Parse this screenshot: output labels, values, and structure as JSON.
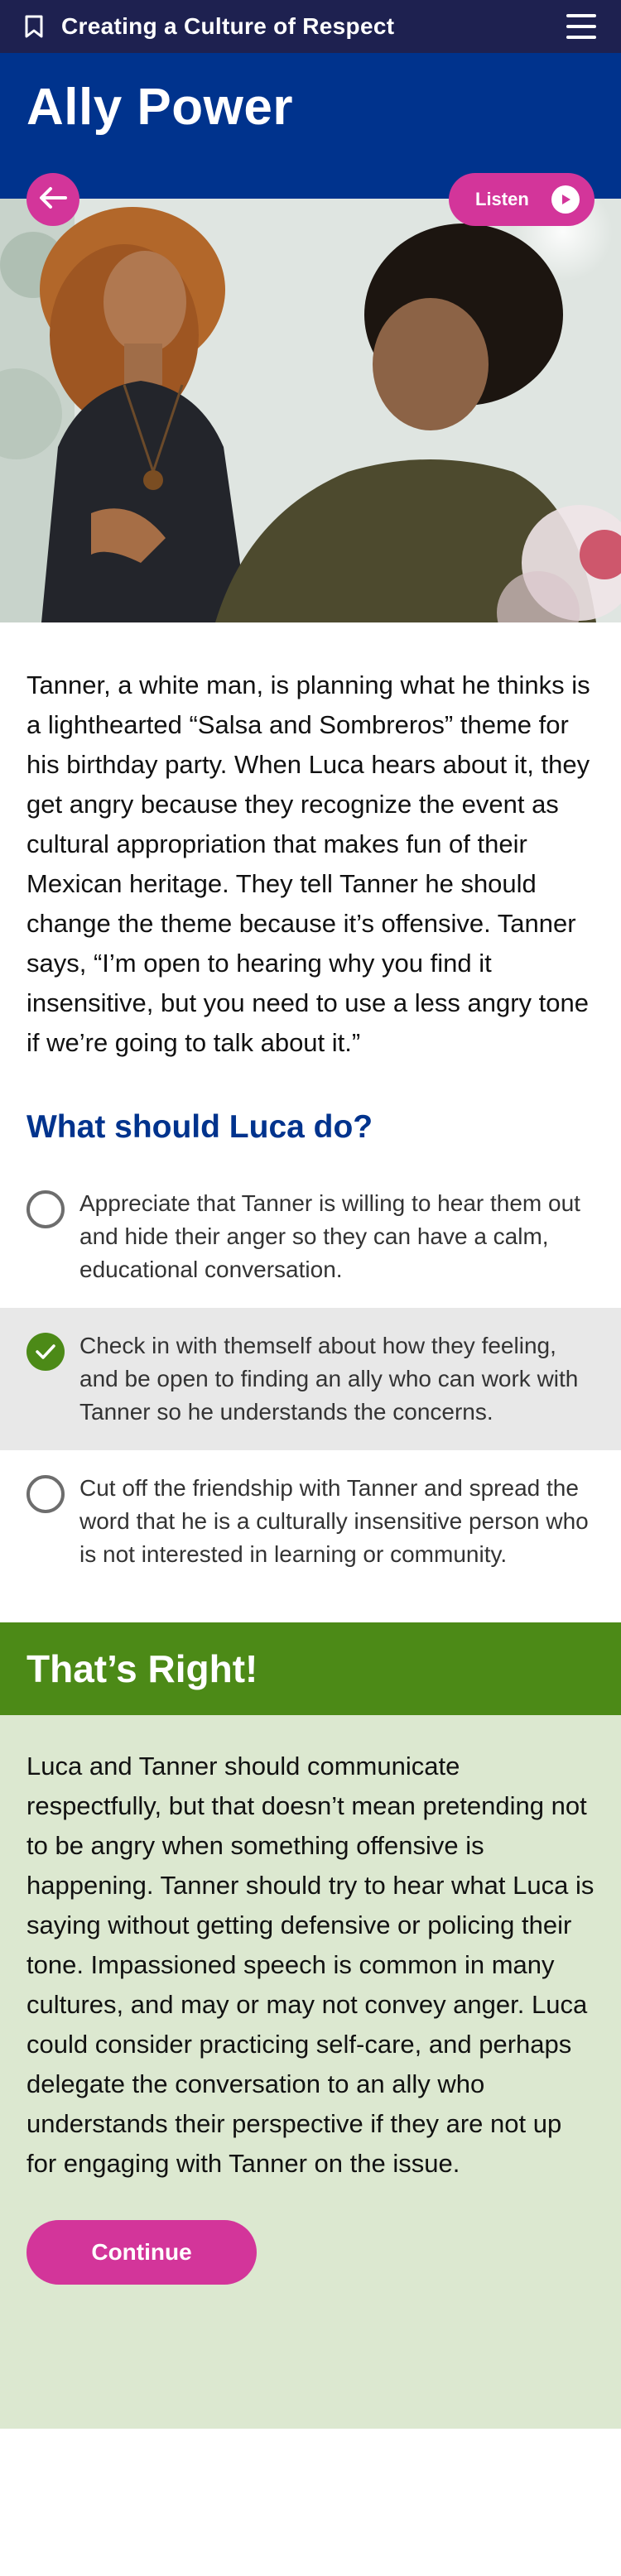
{
  "app": {
    "title": "Creating a Culture of Respect",
    "bookmark_icon": "bookmark-icon",
    "menu_icon": "hamburger-menu-icon"
  },
  "header": {
    "title": "Ally Power",
    "back_icon": "arrow-left-icon",
    "listen_label": "Listen",
    "listen_icon": "play-icon"
  },
  "colors": {
    "topbar": "#1e2150",
    "header": "#00338d",
    "accent": "#d3359a",
    "correct": "#4c8a17",
    "correct_bg": "#dce8d0",
    "selected_bg": "#e8e8e8"
  },
  "scenario": {
    "text": "Tanner, a white man, is planning what he thinks is a lighthearted “Salsa and Sombreros” theme for his birthday party. When Luca hears about it, they get angry because they recognize the event as cultural appropriation that makes fun of their Mexican heritage. They tell Tanner he should change the theme because it’s offensive. Tanner says, “I’m open to hearing why you find it insensitive, but you need to use a less angry tone if we’re going to talk about it.”"
  },
  "question": {
    "title": "What should Luca do?",
    "options": [
      {
        "label": "Appreciate that Tanner is willing to hear them out and hide their anger so they can have a calm, educational conversation.",
        "selected": false
      },
      {
        "label": "Check in with themself about how they feeling, and be open to finding an ally who can work with Tanner so he understands the concerns.",
        "selected": true
      },
      {
        "label": "Cut off the friendship with Tanner and spread the word that he is a culturally insensitive person who is not interested in learning or community.",
        "selected": false
      }
    ]
  },
  "result": {
    "title": "That’s Right!",
    "text": "Luca and Tanner should communicate respectfully, but that doesn’t mean pretending not to be angry when something offensive is happening. Tanner should try to hear what Luca is saying without getting defensive or policing their tone. Impassioned speech is common in many cultures, and may or may not convey anger. Luca could consider practicing self-care, and perhaps delegate the conversation to an ally who understands their perspective if they are not up for engaging with Tanner on the issue.",
    "continue_label": "Continue"
  }
}
